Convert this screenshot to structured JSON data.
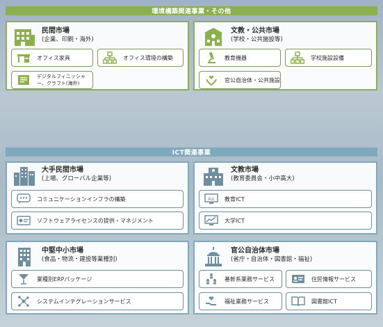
{
  "env": {
    "header": "環境構築関連事業・その他",
    "private": {
      "title": "民間市場",
      "subtitle": "(企業、印刷・海外)",
      "items": [
        "オフィス家具",
        "オフィス環境の構築",
        "デジタルフィニッシャー、クラフト(海外)"
      ]
    },
    "public": {
      "title": "文教・公共市場",
      "subtitle": "(学校・公共施設等)",
      "items": [
        "教育機器",
        "学校施設設備",
        "官公自治体・公共施設"
      ]
    }
  },
  "ict": {
    "header": "ICT関連事業",
    "large_private": {
      "title": "大手民間市場",
      "subtitle": "(上場、グローバル企業等)",
      "items": [
        "コミュニケーションインフラの構築",
        "ソフトウェアライセンスの提供・マネジメント"
      ]
    },
    "education": {
      "title": "文教市場",
      "subtitle": "(教育委員会・小中高大)",
      "items": [
        "教育ICT",
        "大学ICT"
      ]
    },
    "mid_small": {
      "title": "中堅中小市場",
      "subtitle": "(食品・物流・建設等業種別)",
      "items": [
        "業種別ERPパッケージ",
        "システムインテグレーションサービス"
      ]
    },
    "government": {
      "title": "官公自治体市場",
      "subtitle": "(省庁・自治体・図書館・福祉)",
      "items": [
        "基幹系業務サービス",
        "住民情報サービス",
        "福祉業務サービス",
        "図書館ICT"
      ]
    }
  },
  "colors": {
    "env_green": "#8db04f",
    "ict_blue": "#7fa9bd",
    "icon_green": "#8db04f",
    "icon_blue": "#6f8fa0"
  }
}
